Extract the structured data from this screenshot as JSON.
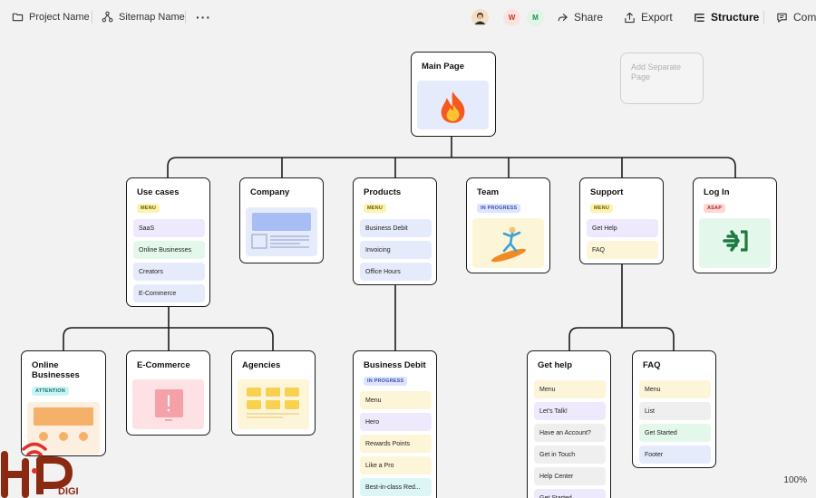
{
  "toolbar": {
    "project_name": "Project Name",
    "sitemap_name": "Sitemap Name",
    "share": "Share",
    "export": "Export",
    "structure": "Structure",
    "comments": "Comm",
    "more_icon": "more-horizontal-icon",
    "avatars": [
      {
        "initial": "",
        "color": "#f0e1c8"
      },
      {
        "initial": "W",
        "color": "#fde2e2",
        "text_color": "#c0392b"
      },
      {
        "initial": "M",
        "color": "#dff5e6",
        "text_color": "#2e8b57"
      }
    ]
  },
  "separate_page": "Add Separate Page",
  "cards": {
    "main": {
      "title": "Main Page",
      "icon": "fire-emoji"
    },
    "use_cases": {
      "title": "Use cases",
      "badge": "MENU",
      "items": [
        "SaaS",
        "Online Businesses",
        "Creators",
        "E-Commerce"
      ]
    },
    "company": {
      "title": "Company"
    },
    "products": {
      "title": "Products",
      "badge": "MENU",
      "items": [
        "Business Debit",
        "Invoicing",
        "Office Hours"
      ]
    },
    "team": {
      "title": "Team",
      "badge": "IN PROGRESS"
    },
    "support": {
      "title": "Support",
      "badge": "MENU",
      "items": [
        "Get Help",
        "FAQ"
      ]
    },
    "login": {
      "title": "Log In",
      "badge": "ASAP"
    },
    "online_businesses": {
      "title": "Online Businesses",
      "badge": "ATTENTION"
    },
    "ecommerce": {
      "title": "E-Commerce"
    },
    "agencies": {
      "title": "Agencies"
    },
    "business_debit": {
      "title": "Business Debit",
      "badge": "IN PROGRESS",
      "items": [
        "Menu",
        "Hero",
        "Rewards Points",
        "Like a Pro",
        "Best-in-class Red..."
      ]
    },
    "get_help": {
      "title": "Get help",
      "items": [
        "Menu",
        "Let's Talk!",
        "Have an Account?",
        "Get in Touch",
        "Help Center",
        "Get Started"
      ]
    },
    "faq": {
      "title": "FAQ",
      "items": [
        "Menu",
        "List",
        "Get Started",
        "Footer"
      ]
    }
  },
  "zoom": "100%",
  "logo": {
    "text": "DIGI"
  },
  "colors": {
    "canvas": "#f2f2f2",
    "card_border": "#1b1b1b",
    "login_arrow": "#1f7a3f"
  }
}
